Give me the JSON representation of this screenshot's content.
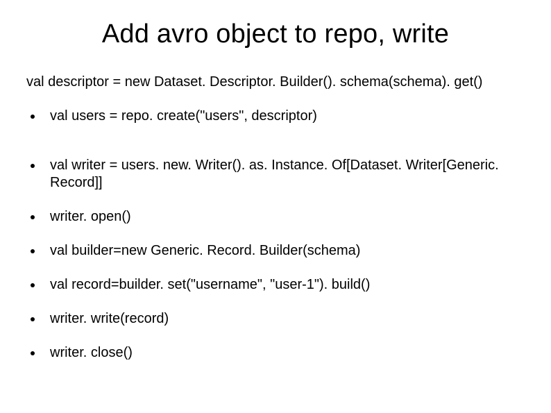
{
  "title": "Add avro object to repo, write",
  "subline": "val descriptor = new Dataset. Descriptor. Builder(). schema(schema). get()",
  "bullets": [
    "val users = repo. create(\"users\", descriptor)",
    "val writer = users. new. Writer(). as. Instance. Of[Dataset. Writer[Generic. Record]]",
    "writer. open()",
    "val builder=new Generic. Record. Builder(schema)",
    "val record=builder. set(\"username\", \"user-1\"). build()",
    "writer. write(record)",
    "writer. close()"
  ]
}
